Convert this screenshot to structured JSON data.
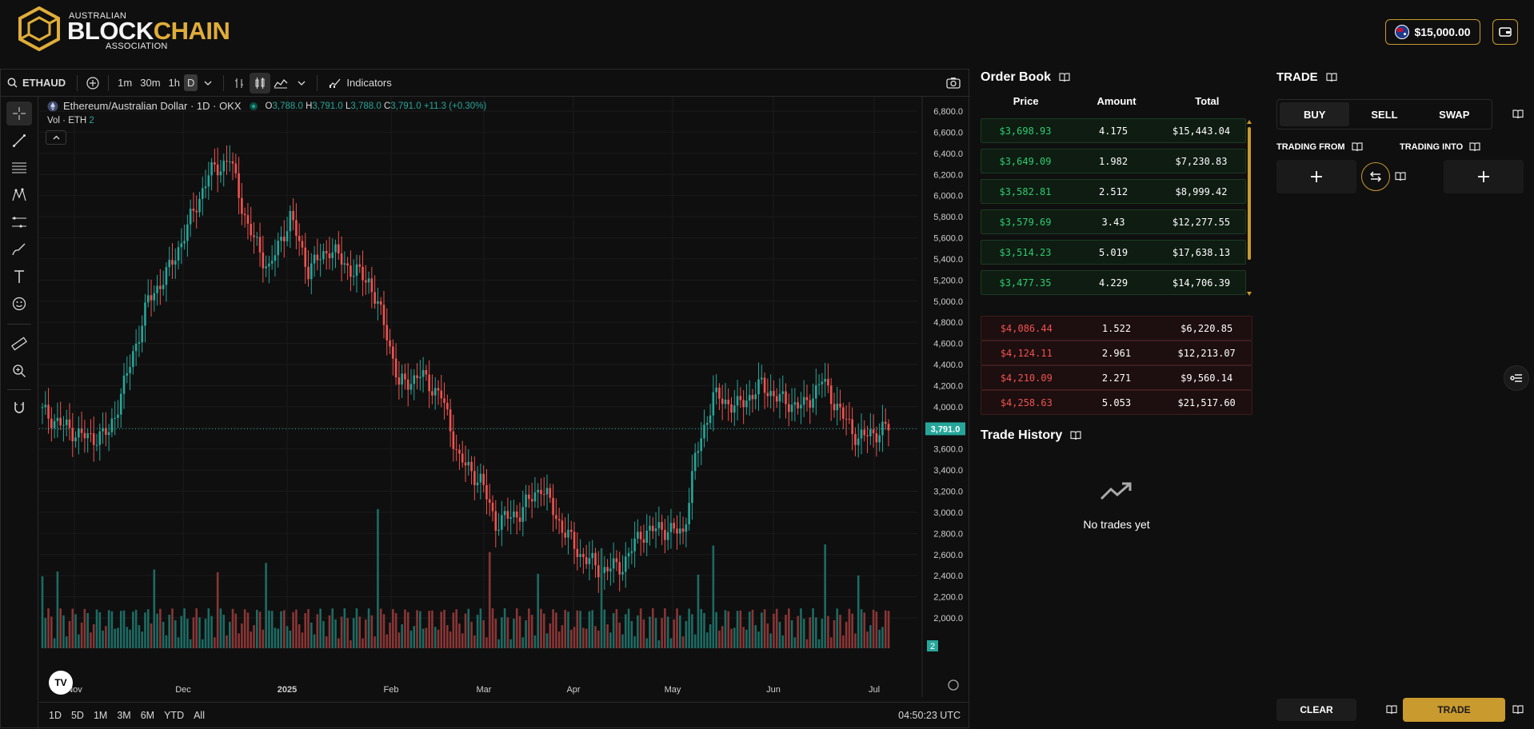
{
  "header": {
    "logo_small_top": "AUSTRALIAN",
    "logo_word_1": "BLOCK",
    "logo_word_2": "CHAIN",
    "logo_small_bottom": "ASSOCIATION",
    "balance": "$15,000.00",
    "flag_icon": "australia-flag-icon",
    "wallet_icon": "wallet-icon",
    "accent": "#c99a2e"
  },
  "chart_toolbar": {
    "symbol": "ETHAUD",
    "timeframes": [
      "1m",
      "30m",
      "1h",
      "D"
    ],
    "active_timeframe": "D",
    "indicators_label": "Indicators"
  },
  "chart_legend": {
    "title": "Ethereum/Australian Dollar · 1D · OKX",
    "o_label": "O",
    "o_val": "3,788.0",
    "h_label": "H",
    "h_val": "3,791.0",
    "l_label": "L",
    "l_val": "3,788.0",
    "c_label": "C",
    "c_val": "3,791.0",
    "change": "+11.3 (+0.30%)",
    "volume_label": "Vol · ETH",
    "volume_val": "2",
    "last_price": "3,791.0",
    "last_volume": "2"
  },
  "ranges": [
    "1D",
    "5D",
    "1M",
    "3M",
    "6M",
    "YTD",
    "All"
  ],
  "clock": "04:50:23 UTC",
  "chart_data": {
    "type": "candlestick",
    "title": "Ethereum/Australian Dollar · 1D · OKX",
    "x_ticks": [
      "Nov",
      "Dec",
      "2025",
      "Feb",
      "Mar",
      "Apr",
      "May",
      "Jun",
      "Jul"
    ],
    "y_ticks": [
      "6,800.0",
      "6,600.0",
      "6,400.0",
      "6,200.0",
      "6,000.0",
      "5,800.0",
      "5,600.0",
      "5,400.0",
      "5,200.0",
      "5,000.0",
      "4,800.0",
      "4,600.0",
      "4,400.0",
      "4,200.0",
      "4,000.0",
      "3,800.0",
      "3,600.0",
      "3,400.0",
      "3,200.0",
      "3,000.0",
      "2,800.0",
      "2,600.0",
      "2,400.0",
      "2,200.0",
      "2,000.0"
    ],
    "y_range": [
      2000,
      6800
    ],
    "approx_close_path": [
      [
        0,
        3950
      ],
      [
        8,
        3800
      ],
      [
        15,
        3700
      ],
      [
        22,
        3750
      ],
      [
        28,
        4300
      ],
      [
        35,
        5000
      ],
      [
        42,
        5300
      ],
      [
        48,
        5700
      ],
      [
        55,
        6200
      ],
      [
        62,
        6350
      ],
      [
        68,
        5700
      ],
      [
        75,
        5300
      ],
      [
        82,
        5800
      ],
      [
        88,
        5300
      ],
      [
        95,
        5500
      ],
      [
        102,
        5300
      ],
      [
        108,
        5200
      ],
      [
        114,
        4700
      ],
      [
        118,
        4200
      ],
      [
        125,
        4300
      ],
      [
        132,
        4100
      ],
      [
        138,
        3500
      ],
      [
        145,
        3300
      ],
      [
        150,
        2900
      ],
      [
        158,
        3000
      ],
      [
        165,
        3250
      ],
      [
        172,
        2850
      ],
      [
        178,
        2600
      ],
      [
        185,
        2450
      ],
      [
        192,
        2500
      ],
      [
        198,
        2800
      ],
      [
        205,
        2850
      ],
      [
        212,
        2800
      ],
      [
        216,
        3500
      ],
      [
        222,
        4100
      ],
      [
        230,
        4000
      ],
      [
        238,
        4200
      ],
      [
        245,
        4050
      ],
      [
        252,
        4000
      ],
      [
        258,
        4250
      ],
      [
        265,
        3900
      ],
      [
        270,
        3700
      ],
      [
        275,
        3750
      ],
      [
        280,
        3800
      ]
    ]
  },
  "order_book": {
    "title": "Order Book",
    "headers": [
      "Price",
      "Amount",
      "Total"
    ],
    "bids": [
      [
        "$3,698.93",
        "4.175",
        "$15,443.04"
      ],
      [
        "$3,649.09",
        "1.982",
        "$7,230.83"
      ],
      [
        "$3,582.81",
        "2.512",
        "$8,999.42"
      ],
      [
        "$3,579.69",
        "3.43",
        "$12,277.55"
      ],
      [
        "$3,514.23",
        "5.019",
        "$17,638.13"
      ],
      [
        "$3,477.35",
        "4.229",
        "$14,706.39"
      ]
    ],
    "asks": [
      [
        "$4,086.44",
        "1.522",
        "$6,220.85"
      ],
      [
        "$4,124.11",
        "2.961",
        "$12,213.07"
      ],
      [
        "$4,210.09",
        "2.271",
        "$9,560.14"
      ],
      [
        "$4,258.63",
        "5.053",
        "$21,517.60"
      ]
    ],
    "bid_color": "#2ecc71",
    "ask_color": "#ef5350"
  },
  "trade_history": {
    "title": "Trade History",
    "empty": "No trades yet"
  },
  "trade_panel": {
    "title": "TRADE",
    "tabs": [
      "BUY",
      "SELL",
      "SWAP"
    ],
    "active_tab": "BUY",
    "trading_from": "TRADING FROM",
    "trading_into": "TRADING INTO",
    "clear": "CLEAR",
    "trade": "TRADE"
  }
}
